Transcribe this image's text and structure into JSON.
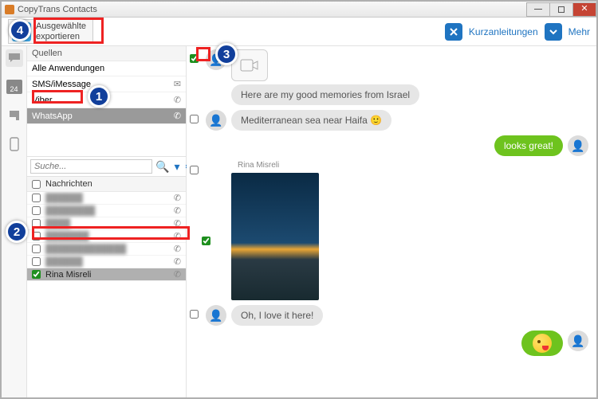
{
  "window": {
    "title": "CopyTrans Contacts"
  },
  "toolbar": {
    "export_line1": "Ausgewählte",
    "export_line2": "exportieren",
    "help_label": "Kurzanleitungen",
    "more_label": "Mehr"
  },
  "nav": {
    "calendar_day": "24"
  },
  "sources": {
    "header": "Quellen",
    "items": [
      {
        "label": "Alle Anwendungen"
      },
      {
        "label": "SMS/iMessage"
      },
      {
        "label": "Viber"
      },
      {
        "label": "WhatsApp",
        "selected": true
      }
    ]
  },
  "search": {
    "placeholder": "Suche..."
  },
  "messages": {
    "header": "Nachrichten",
    "rows": [
      {
        "label": "",
        "blurred": true,
        "checked": false
      },
      {
        "label": "",
        "blurred": true,
        "checked": false
      },
      {
        "label": "",
        "blurred": true,
        "checked": false
      },
      {
        "label": "",
        "blurred": true,
        "checked": false
      },
      {
        "label": "",
        "blurred": true,
        "checked": false
      },
      {
        "label": "",
        "blurred": true,
        "checked": false
      },
      {
        "label": "Rina Misreli",
        "blurred": false,
        "checked": true,
        "selected": true
      }
    ]
  },
  "chat": {
    "sender_name": "Rina Misreli",
    "incoming": [
      "Here are my good memories from Israel",
      "Mediterranean sea near Haifa 🙂",
      "Oh, I love it here!"
    ],
    "outgoing": [
      "looks great!"
    ]
  },
  "annotations": {
    "n1": "1",
    "n2": "2",
    "n3": "3",
    "n4": "4"
  }
}
